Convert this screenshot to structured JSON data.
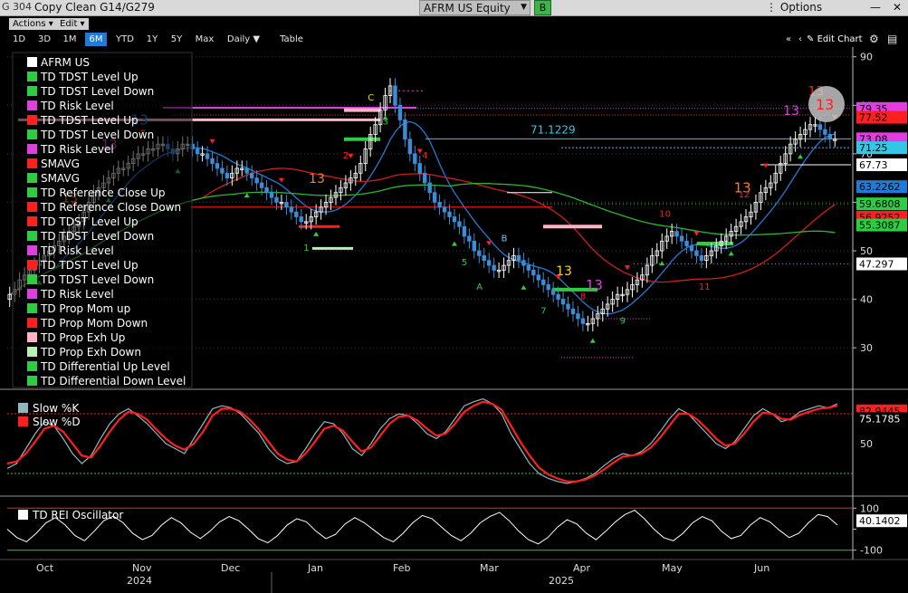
{
  "window": {
    "app_label": "G 304",
    "title": "Copy Clean G14/G279",
    "ticker": "AFRM US Equity",
    "ticker_badge": "B",
    "options_label": "Options",
    "minimize_label": "—",
    "close_label": "✕"
  },
  "menus": {
    "actions": "Actions ▾",
    "edit": "Edit ▾"
  },
  "ranges": {
    "items": [
      "1D",
      "3D",
      "1M",
      "6M",
      "YTD",
      "1Y",
      "5Y",
      "Max"
    ],
    "selected": "6M",
    "frequency": "Daily ▼",
    "table_label": "Table",
    "edit_chart_label": "Edit Chart",
    "nav_back": "«",
    "nav_fwd": "‹",
    "gear_glyph": "⚙",
    "layout_glyph": "▤"
  },
  "legend": [
    {
      "label": "AFRM US",
      "color": "#ffffff"
    },
    {
      "label": "TD TDST Level Up",
      "color": "#2ecc40"
    },
    {
      "label": "TD TDST Level Down",
      "color": "#2ecc40"
    },
    {
      "label": "TD Risk Level",
      "color": "#e23ce2"
    },
    {
      "label": "TD TDST Level Up",
      "color": "#ff1f1f"
    },
    {
      "label": "TD TDST Level Down",
      "color": "#2ecc40"
    },
    {
      "label": "TD Risk Level",
      "color": "#e23ce2"
    },
    {
      "label": "SMAVG",
      "color": "#ff1f1f"
    },
    {
      "label": "SMAVG",
      "color": "#2ecc40"
    },
    {
      "label": "TD Reference Close Up",
      "color": "#2ecc40"
    },
    {
      "label": "TD Reference Close Down",
      "color": "#ff1f1f"
    },
    {
      "label": "TD TDST Level Up",
      "color": "#ff1f1f"
    },
    {
      "label": "TD TDST Level Down",
      "color": "#2ecc40"
    },
    {
      "label": "TD Risk Level",
      "color": "#e23ce2"
    },
    {
      "label": "TD TDST Level Up",
      "color": "#ff1f1f"
    },
    {
      "label": "TD TDST Level Down",
      "color": "#2ecc40"
    },
    {
      "label": "TD Risk Level",
      "color": "#e23ce2"
    },
    {
      "label": "TD Prop Mom up",
      "color": "#2ecc40"
    },
    {
      "label": "TD Prop Mom Down",
      "color": "#ff1f1f"
    },
    {
      "label": "TD Prop Exh Up",
      "color": "#ffb3c6"
    },
    {
      "label": "TD Prop Exh Down",
      "color": "#b8f0b8"
    },
    {
      "label": "TD Differential Up Level",
      "color": "#2ecc40"
    },
    {
      "label": "TD Differential Down Level",
      "color": "#2ecc40"
    }
  ],
  "chart_data": [
    {
      "type": "line",
      "panel": "price",
      "x_ticks": [
        "Oct",
        "Nov",
        "Dec",
        "Jan",
        "Feb",
        "Mar",
        "Apr",
        "May",
        "Jun"
      ],
      "years": [
        "2024",
        "2025"
      ],
      "ylim": [
        22,
        92
      ],
      "y_ticks": [
        30,
        40,
        50,
        60,
        70,
        80,
        90
      ],
      "close": [
        41,
        42,
        44,
        45,
        46,
        47,
        48,
        49,
        50,
        51,
        52,
        53,
        54,
        55,
        56,
        58,
        60,
        62,
        63,
        64,
        65,
        66,
        67,
        67,
        68,
        69,
        70,
        70,
        71,
        71,
        72,
        72,
        71,
        70,
        71,
        72,
        72,
        71,
        70,
        70,
        69,
        68,
        67,
        66,
        65,
        66,
        67,
        67,
        66,
        65,
        64,
        63,
        62,
        61,
        60,
        60,
        59,
        58,
        57,
        56,
        56,
        57,
        58,
        59,
        60,
        61,
        62,
        63,
        64,
        65,
        66,
        68,
        71,
        74,
        76,
        79,
        82,
        84,
        80,
        77,
        73,
        70,
        68,
        66,
        64,
        62,
        60,
        59,
        58,
        57,
        56,
        55,
        53,
        52,
        50,
        49,
        48,
        47,
        46,
        46,
        47,
        48,
        49,
        48,
        47,
        46,
        45,
        44,
        43,
        42,
        41,
        40,
        39,
        38,
        37,
        36,
        35,
        35,
        36,
        37,
        38,
        39,
        40,
        41,
        41,
        42,
        43,
        44,
        45,
        47,
        49,
        50,
        52,
        53,
        54,
        53,
        52,
        51,
        50,
        49,
        48,
        49,
        50,
        51,
        52,
        53,
        54,
        55,
        56,
        57,
        58,
        60,
        62,
        63,
        64,
        66,
        68,
        70,
        72,
        73,
        74,
        75,
        76,
        76,
        75,
        74,
        73,
        73
      ],
      "annotations": [
        "13",
        "13",
        "13",
        "13",
        "13",
        "13",
        "13",
        "13",
        "13",
        "1",
        "2",
        "3",
        "4",
        "5",
        "6",
        "7",
        "8",
        "9",
        "10",
        "11",
        "12",
        "A",
        "B",
        "C"
      ],
      "price_label": "71.1229",
      "right_labels": [
        {
          "value": "79.35",
          "color": "#e23ce2"
        },
        {
          "value": "77.52",
          "color": "#ff1f1f"
        },
        {
          "value": "73.08",
          "color": "#e23ce2"
        },
        {
          "value": "71.25",
          "color": "#33c7e6"
        },
        {
          "value": "67.73",
          "color": "#ffffff"
        },
        {
          "value": "63.2262",
          "color": "#1f7bd6"
        },
        {
          "value": "59.6808",
          "color": "#2ecc40"
        },
        {
          "value": "56.9252",
          "color": "#ff1f1f"
        },
        {
          "value": "55.3087",
          "color": "#2ecc40"
        },
        {
          "value": "47.297",
          "color": "#000000"
        }
      ],
      "colors": {
        "sma_blue": "#1f7bd6",
        "sma_red": "#cc1f1f",
        "sma_green": "#2db52d",
        "up": "#ffffff",
        "down": "#3a8ed8"
      }
    },
    {
      "type": "line",
      "panel": "stochastic",
      "series": [
        {
          "name": "Slow %K",
          "color": "#8fb9bf"
        },
        {
          "name": "Slow %D",
          "color": "#ff1f1f"
        }
      ],
      "ylim": [
        0,
        100
      ],
      "y_ticks": [
        50
      ],
      "k": [
        25,
        30,
        45,
        60,
        72,
        68,
        55,
        40,
        30,
        38,
        55,
        70,
        80,
        85,
        78,
        70,
        60,
        50,
        45,
        40,
        55,
        70,
        85,
        88,
        86,
        80,
        70,
        60,
        45,
        35,
        30,
        32,
        45,
        60,
        72,
        70,
        60,
        45,
        38,
        50,
        65,
        75,
        80,
        78,
        70,
        60,
        55,
        62,
        75,
        88,
        92,
        95,
        90,
        80,
        60,
        45,
        30,
        20,
        15,
        12,
        10,
        12,
        15,
        20,
        28,
        35,
        40,
        38,
        42,
        50,
        62,
        75,
        85,
        80,
        70,
        60,
        50,
        45,
        52,
        65,
        78,
        85,
        80,
        72,
        75,
        82,
        85,
        88,
        86,
        90
      ],
      "d": [
        30,
        32,
        40,
        52,
        65,
        68,
        62,
        50,
        38,
        36,
        48,
        62,
        74,
        82,
        80,
        74,
        64,
        55,
        48,
        44,
        50,
        62,
        78,
        85,
        85,
        82,
        74,
        64,
        52,
        40,
        34,
        32,
        40,
        52,
        65,
        68,
        63,
        52,
        42,
        46,
        58,
        70,
        77,
        78,
        73,
        65,
        58,
        60,
        70,
        82,
        88,
        92,
        90,
        84,
        68,
        52,
        38,
        26,
        19,
        15,
        12,
        12,
        14,
        18,
        24,
        31,
        37,
        38,
        40,
        46,
        56,
        68,
        80,
        80,
        74,
        65,
        55,
        48,
        50,
        60,
        72,
        81,
        80,
        75,
        74,
        79,
        82,
        85,
        86,
        88
      ],
      "right_labels": [
        {
          "value": "82.9445",
          "color": "#ff1f1f"
        },
        {
          "value": "75.1785",
          "color": "#ffffff"
        }
      ]
    },
    {
      "type": "line",
      "panel": "rei",
      "series": [
        {
          "name": "TD REI Oscillator",
          "color": "#ffffff"
        }
      ],
      "ylim": [
        -140,
        140
      ],
      "y_ticks": [
        100,
        0,
        -100
      ],
      "tick_labels": [
        "100",
        "",
        "-100"
      ],
      "values": [
        0,
        -40,
        -60,
        -20,
        30,
        55,
        20,
        -30,
        -55,
        -10,
        40,
        62,
        30,
        -20,
        -50,
        -30,
        20,
        55,
        30,
        -15,
        -45,
        -10,
        35,
        60,
        40,
        0,
        -45,
        -65,
        -30,
        20,
        50,
        35,
        -10,
        -45,
        -25,
        25,
        55,
        30,
        -5,
        -40,
        -60,
        -20,
        30,
        65,
        50,
        10,
        -30,
        -55,
        -20,
        30,
        60,
        80,
        40,
        -10,
        -50,
        -70,
        -40,
        10,
        45,
        25,
        -20,
        -50,
        -10,
        35,
        70,
        90,
        50,
        0,
        -40,
        -55,
        -20,
        30,
        60,
        40,
        -10,
        -45,
        -30,
        20,
        55,
        35,
        -5,
        -40,
        -20,
        30,
        70,
        60,
        20
      ],
      "current_label": "40.1402"
    }
  ]
}
